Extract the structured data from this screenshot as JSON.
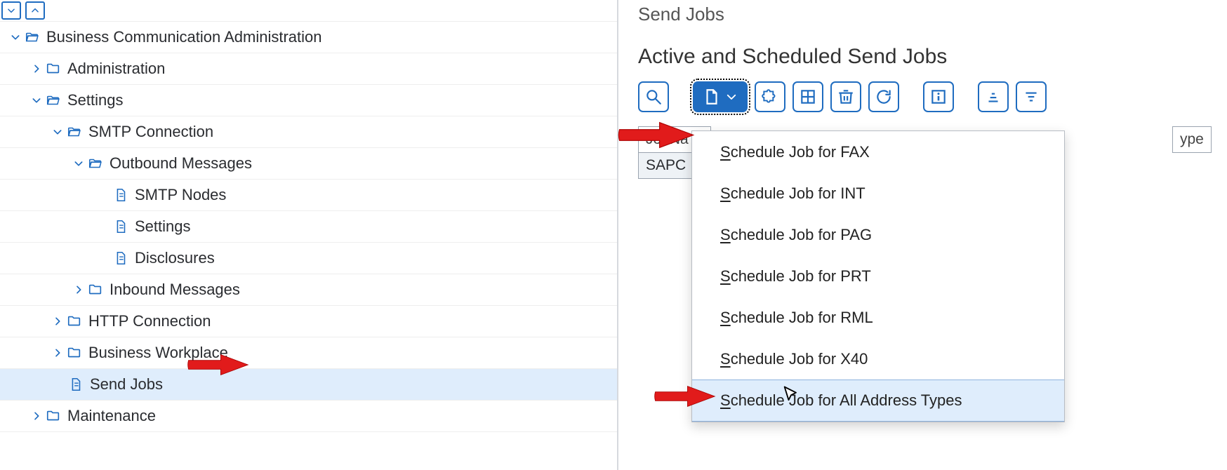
{
  "tree": {
    "root_label": "Business Communication Administration",
    "administration": "Administration",
    "settings": "Settings",
    "smtp_conn": "SMTP Connection",
    "outbound": "Outbound Messages",
    "smtp_nodes": "SMTP Nodes",
    "settings_leaf": "Settings",
    "disclosures": "Disclosures",
    "inbound": "Inbound Messages",
    "http_conn": "HTTP Connection",
    "biz_workplace": "Business Workplace",
    "send_jobs": "Send Jobs",
    "maintenance": "Maintenance"
  },
  "main": {
    "page_title": "Send Jobs",
    "section_title": "Active and Scheduled Send Jobs",
    "col_jobname": "JobNa",
    "col_type": "ype",
    "row0_jobname": "SAPC"
  },
  "dropdown": {
    "items": [
      "chedule Job for FAX",
      "chedule Job for INT",
      "chedule Job for PAG",
      "chedule Job for PRT",
      "chedule Job for RML",
      "chedule Job for X40",
      "chedule Job for All Address Types"
    ],
    "hotkey": "S"
  },
  "icons": {
    "search": "search-icon",
    "new": "new-document-icon",
    "puzzle": "puzzle-icon",
    "grid": "table-icon",
    "trash": "trash-icon",
    "refresh": "refresh-icon",
    "info": "info-icon",
    "sort-asc": "sort-asc-icon",
    "filter": "filter-icon"
  }
}
